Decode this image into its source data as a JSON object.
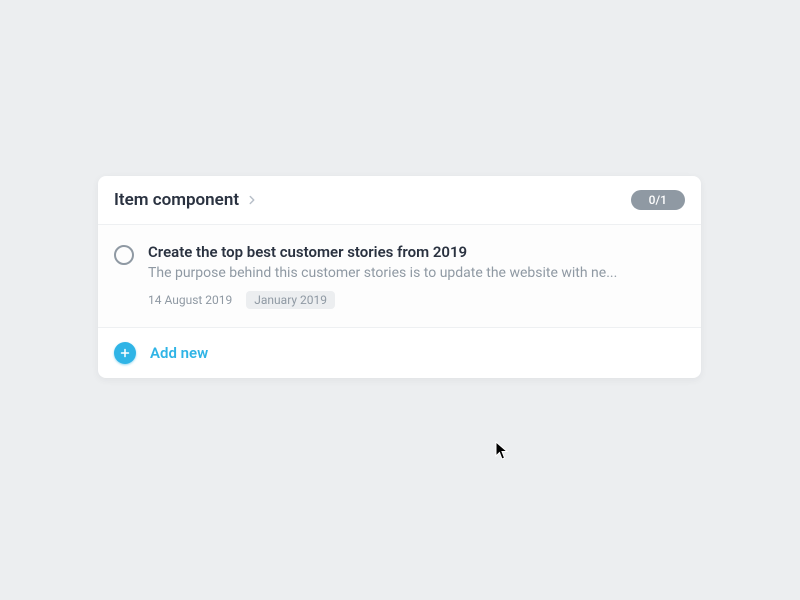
{
  "card": {
    "title": "Item component",
    "badge": "0/1"
  },
  "items": [
    {
      "title": "Create the top best customer stories from 2019",
      "description": "The purpose behind this customer stories is to update the website with ne...",
      "date": "14 August 2019",
      "tag": "January 2019"
    }
  ],
  "footer": {
    "add_label": "Add new"
  }
}
